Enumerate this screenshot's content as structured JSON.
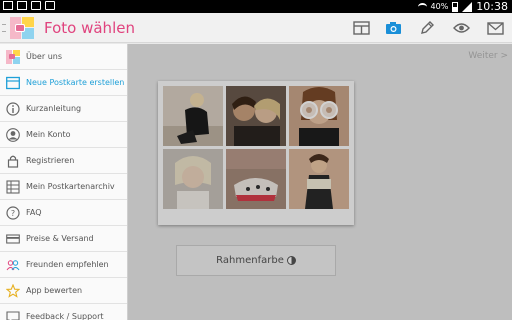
{
  "status_bar": {
    "battery": "40%",
    "time": "10:38"
  },
  "action_bar": {
    "title": "Foto wählen",
    "icons": [
      "layout-icon",
      "camera-icon",
      "pencil-icon",
      "eye-icon",
      "mail-icon"
    ],
    "active_icon_color": "#1a8fd8"
  },
  "drawer": {
    "items": [
      {
        "label": "Über uns",
        "icon": "app-logo-icon"
      },
      {
        "label": "Neue Postkarte erstellen",
        "icon": "new-postcard-icon",
        "active": true
      },
      {
        "label": "Kurzanleitung",
        "icon": "info-icon"
      },
      {
        "label": "Mein Konto",
        "icon": "user-icon"
      },
      {
        "label": "Registrieren",
        "icon": "lock-icon"
      },
      {
        "label": "Mein Postkartenarchiv",
        "icon": "archive-icon"
      },
      {
        "label": "FAQ",
        "icon": "help-icon"
      },
      {
        "label": "Preise & Versand",
        "icon": "credit-card-icon"
      },
      {
        "label": "Freunden empfehlen",
        "icon": "friends-icon"
      },
      {
        "label": "App bewerten",
        "icon": "star-icon"
      },
      {
        "label": "Feedback / Support",
        "icon": "feedback-icon"
      }
    ]
  },
  "main": {
    "next_label": "Weiter >",
    "frame_color_label": "Rahmenfarbe"
  },
  "colors": {
    "accent": "#e0437e",
    "active_nav": "#1fa0d8"
  }
}
